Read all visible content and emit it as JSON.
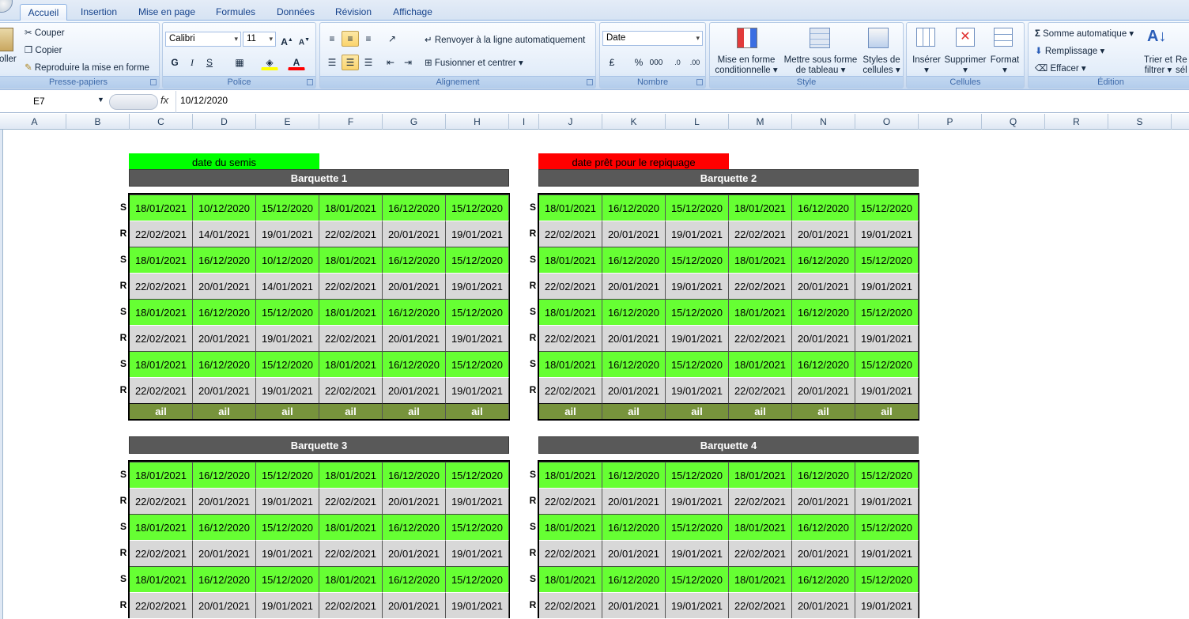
{
  "tabs": [
    "Accueil",
    "Insertion",
    "Mise en page",
    "Formules",
    "Données",
    "Révision",
    "Affichage"
  ],
  "ribbon": {
    "clipboard": {
      "paste": "oller",
      "cut": "Couper",
      "copy": "Copier",
      "painter": "Reproduire la mise en forme",
      "title": "Presse-papiers"
    },
    "font": {
      "name": "Calibri",
      "size": "11",
      "bold": "G",
      "italic": "I",
      "underline": "S",
      "title": "Police"
    },
    "alignment": {
      "wrap": "Renvoyer à la ligne automatiquement",
      "merge": "Fusionner et centrer",
      "title": "Alignement"
    },
    "number": {
      "format": "Date",
      "percent": "%",
      "thousands": "000",
      "title": "Nombre"
    },
    "style": {
      "cond_line1": "Mise en forme",
      "cond_line2": "conditionnelle",
      "table_line1": "Mettre sous forme",
      "table_line2": "de tableau",
      "cell_line1": "Styles de",
      "cell_line2": "cellules",
      "title": "Style"
    },
    "cells": {
      "insert": "Insérer",
      "delete": "Supprimer",
      "format": "Format",
      "title": "Cellules"
    },
    "editing": {
      "autosum": "Somme automatique",
      "fill": "Remplissage",
      "clear": "Effacer",
      "sort_line1": "Trier et",
      "sort_line2": "filtrer",
      "find_line1": "Re",
      "find_line2": "sél",
      "title": "Édition"
    }
  },
  "formula_bar": {
    "name_box": "E7",
    "fx": "fx",
    "value": "10/12/2020"
  },
  "columns": [
    "A",
    "B",
    "C",
    "D",
    "E",
    "F",
    "G",
    "H",
    "I",
    "J",
    "K",
    "L",
    "M",
    "N",
    "O",
    "P",
    "Q",
    "R",
    "S"
  ],
  "legend": {
    "sowing": "date du semis",
    "transplant": "date prêt pour le repiquage",
    "sowing_color": "#00ff00",
    "transplant_color": "#ff0000"
  },
  "row_labels": {
    "s": "S",
    "r": "R"
  },
  "footer_label": "ail",
  "trays": [
    {
      "title": "Barquette 1",
      "rows": [
        [
          "18/01/2021",
          "10/12/2020",
          "15/12/2020",
          "18/01/2021",
          "16/12/2020",
          "15/12/2020"
        ],
        [
          "22/02/2021",
          "14/01/2021",
          "19/01/2021",
          "22/02/2021",
          "20/01/2021",
          "19/01/2021"
        ],
        [
          "18/01/2021",
          "16/12/2020",
          "10/12/2020",
          "18/01/2021",
          "16/12/2020",
          "15/12/2020"
        ],
        [
          "22/02/2021",
          "20/01/2021",
          "14/01/2021",
          "22/02/2021",
          "20/01/2021",
          "19/01/2021"
        ],
        [
          "18/01/2021",
          "16/12/2020",
          "15/12/2020",
          "18/01/2021",
          "16/12/2020",
          "15/12/2020"
        ],
        [
          "22/02/2021",
          "20/01/2021",
          "19/01/2021",
          "22/02/2021",
          "20/01/2021",
          "19/01/2021"
        ],
        [
          "18/01/2021",
          "16/12/2020",
          "15/12/2020",
          "18/01/2021",
          "16/12/2020",
          "15/12/2020"
        ],
        [
          "22/02/2021",
          "20/01/2021",
          "19/01/2021",
          "22/02/2021",
          "20/01/2021",
          "19/01/2021"
        ]
      ]
    },
    {
      "title": "Barquette 2",
      "rows": [
        [
          "18/01/2021",
          "16/12/2020",
          "15/12/2020",
          "18/01/2021",
          "16/12/2020",
          "15/12/2020"
        ],
        [
          "22/02/2021",
          "20/01/2021",
          "19/01/2021",
          "22/02/2021",
          "20/01/2021",
          "19/01/2021"
        ],
        [
          "18/01/2021",
          "16/12/2020",
          "15/12/2020",
          "18/01/2021",
          "16/12/2020",
          "15/12/2020"
        ],
        [
          "22/02/2021",
          "20/01/2021",
          "19/01/2021",
          "22/02/2021",
          "20/01/2021",
          "19/01/2021"
        ],
        [
          "18/01/2021",
          "16/12/2020",
          "15/12/2020",
          "18/01/2021",
          "16/12/2020",
          "15/12/2020"
        ],
        [
          "22/02/2021",
          "20/01/2021",
          "19/01/2021",
          "22/02/2021",
          "20/01/2021",
          "19/01/2021"
        ],
        [
          "18/01/2021",
          "16/12/2020",
          "15/12/2020",
          "18/01/2021",
          "16/12/2020",
          "15/12/2020"
        ],
        [
          "22/02/2021",
          "20/01/2021",
          "19/01/2021",
          "22/02/2021",
          "20/01/2021",
          "19/01/2021"
        ]
      ]
    },
    {
      "title": "Barquette 3",
      "rows": [
        [
          "18/01/2021",
          "16/12/2020",
          "15/12/2020",
          "18/01/2021",
          "16/12/2020",
          "15/12/2020"
        ],
        [
          "22/02/2021",
          "20/01/2021",
          "19/01/2021",
          "22/02/2021",
          "20/01/2021",
          "19/01/2021"
        ],
        [
          "18/01/2021",
          "16/12/2020",
          "15/12/2020",
          "18/01/2021",
          "16/12/2020",
          "15/12/2020"
        ],
        [
          "22/02/2021",
          "20/01/2021",
          "19/01/2021",
          "22/02/2021",
          "20/01/2021",
          "19/01/2021"
        ],
        [
          "18/01/2021",
          "16/12/2020",
          "15/12/2020",
          "18/01/2021",
          "16/12/2020",
          "15/12/2020"
        ],
        [
          "22/02/2021",
          "20/01/2021",
          "19/01/2021",
          "22/02/2021",
          "20/01/2021",
          "19/01/2021"
        ]
      ]
    },
    {
      "title": "Barquette 4",
      "rows": [
        [
          "18/01/2021",
          "16/12/2020",
          "15/12/2020",
          "18/01/2021",
          "16/12/2020",
          "15/12/2020"
        ],
        [
          "22/02/2021",
          "20/01/2021",
          "19/01/2021",
          "22/02/2021",
          "20/01/2021",
          "19/01/2021"
        ],
        [
          "18/01/2021",
          "16/12/2020",
          "15/12/2020",
          "18/01/2021",
          "16/12/2020",
          "15/12/2020"
        ],
        [
          "22/02/2021",
          "20/01/2021",
          "19/01/2021",
          "22/02/2021",
          "20/01/2021",
          "19/01/2021"
        ],
        [
          "18/01/2021",
          "16/12/2020",
          "15/12/2020",
          "18/01/2021",
          "16/12/2020",
          "15/12/2020"
        ],
        [
          "22/02/2021",
          "20/01/2021",
          "19/01/2021",
          "22/02/2021",
          "20/01/2021",
          "19/01/2021"
        ]
      ]
    }
  ]
}
